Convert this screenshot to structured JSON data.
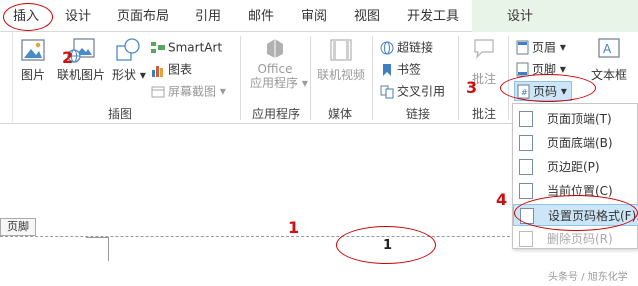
{
  "tabs": [
    "插入",
    "设计",
    "页面布局",
    "引用",
    "邮件",
    "审阅",
    "视图",
    "开发工具"
  ],
  "context_tab": "设计",
  "groups": {
    "illustrations": {
      "label": "插图",
      "picture": "图片",
      "online_picture": "联机图片",
      "shapes": "形状",
      "smartart": "SmartArt",
      "chart": "图表",
      "screenshot": "屏幕截图"
    },
    "apps": {
      "label": "应用程序",
      "office_line1": "Office",
      "office_line2": "应用程序"
    },
    "media": {
      "label": "媒体",
      "online_video": "联机视频"
    },
    "links": {
      "label": "链接",
      "hyperlink": "超链接",
      "bookmark": "书签",
      "cross_ref": "交叉引用"
    },
    "comments": {
      "label": "批注",
      "comment": "批注"
    },
    "header_footer": {
      "header": "页眉",
      "footer": "页脚",
      "page_number": "页码"
    },
    "text": {
      "textbox": "文本框"
    }
  },
  "document": {
    "footer_tag": "页脚",
    "page_num_value": "1"
  },
  "menu": {
    "items": [
      "页面顶端(T)",
      "页面底端(B)",
      "页边距(P)",
      "当前位置(C)",
      "设置页码格式(F)...",
      "删除页码(R)"
    ]
  },
  "annotations": {
    "n1": "1",
    "n2": "2",
    "n3": "3",
    "n4": "4"
  },
  "watermark": "头条号 / 旭东化学",
  "colors": {
    "annotation_red": "#d01010",
    "context_green": "#e8f4e7",
    "menu_highlight": "#cde6f7"
  }
}
